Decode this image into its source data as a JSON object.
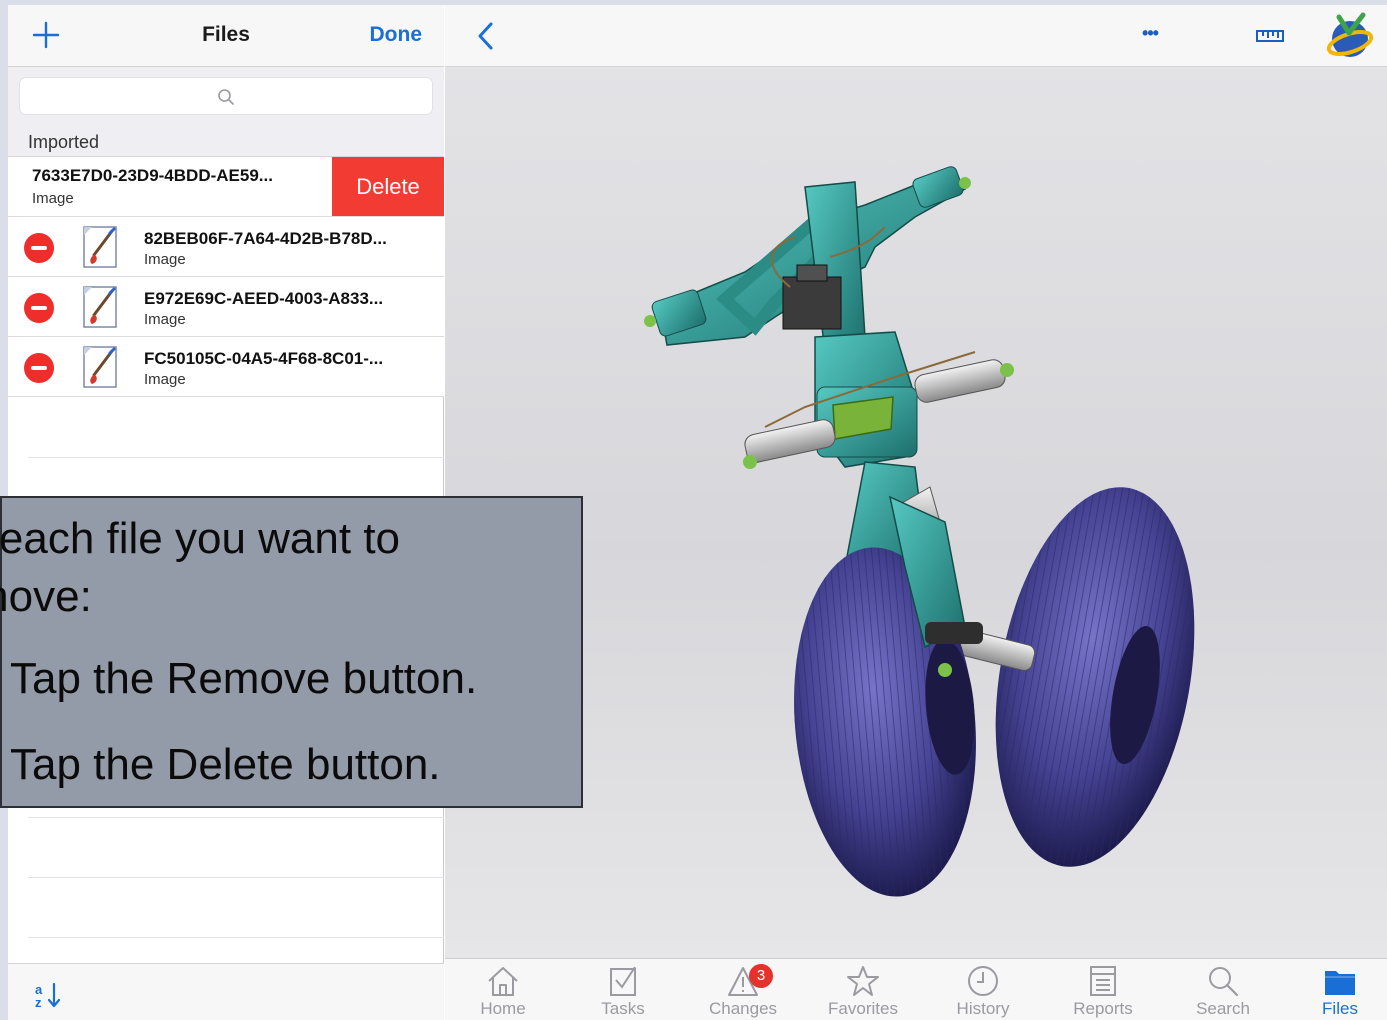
{
  "left_panel": {
    "title": "Files",
    "add_icon": "plus-icon",
    "done_label": "Done",
    "search": {
      "placeholder": "",
      "icon": "search-icon"
    },
    "section_title": "Imported",
    "swiped_item": {
      "name": "7633E7D0-23D9-4BDD-AE59...",
      "type": "Image",
      "delete_label": "Delete"
    },
    "items": [
      {
        "name": "82BEB06F-7A64-4D2B-B78D...",
        "type": "Image"
      },
      {
        "name": "E972E69C-AEED-4003-A833...",
        "type": "Image"
      },
      {
        "name": "FC50105C-04A5-4F68-8C01-...",
        "type": "Image"
      }
    ],
    "sort_icon": "sort-icon"
  },
  "right_panel": {
    "back_icon": "chevron-left-icon",
    "more_label": "•••",
    "measure_icon": "ruler-icon",
    "logo_icon": "app-logo-icon",
    "model": "landing-gear-3d-model"
  },
  "tab_bar": {
    "tabs": [
      {
        "label": "Home",
        "icon": "home-icon"
      },
      {
        "label": "Tasks",
        "icon": "tasks-icon"
      },
      {
        "label": "Changes",
        "icon": "changes-icon",
        "badge": "3"
      },
      {
        "label": "Favorites",
        "icon": "star-icon"
      },
      {
        "label": "History",
        "icon": "clock-icon"
      },
      {
        "label": "Reports",
        "icon": "reports-icon"
      },
      {
        "label": "Search",
        "icon": "search-icon"
      },
      {
        "label": "Files",
        "icon": "folder-icon"
      }
    ],
    "active": "Files"
  },
  "callout": {
    "line1": "r each file you want to",
    "line2": "move:",
    "step1": "Tap the Remove button.",
    "step2": "Tap the Delete button."
  },
  "colors": {
    "accent": "#1a6fd6",
    "delete": "#f23b32",
    "remove": "#ef2d2a",
    "callout_bg": "#949ba8"
  }
}
